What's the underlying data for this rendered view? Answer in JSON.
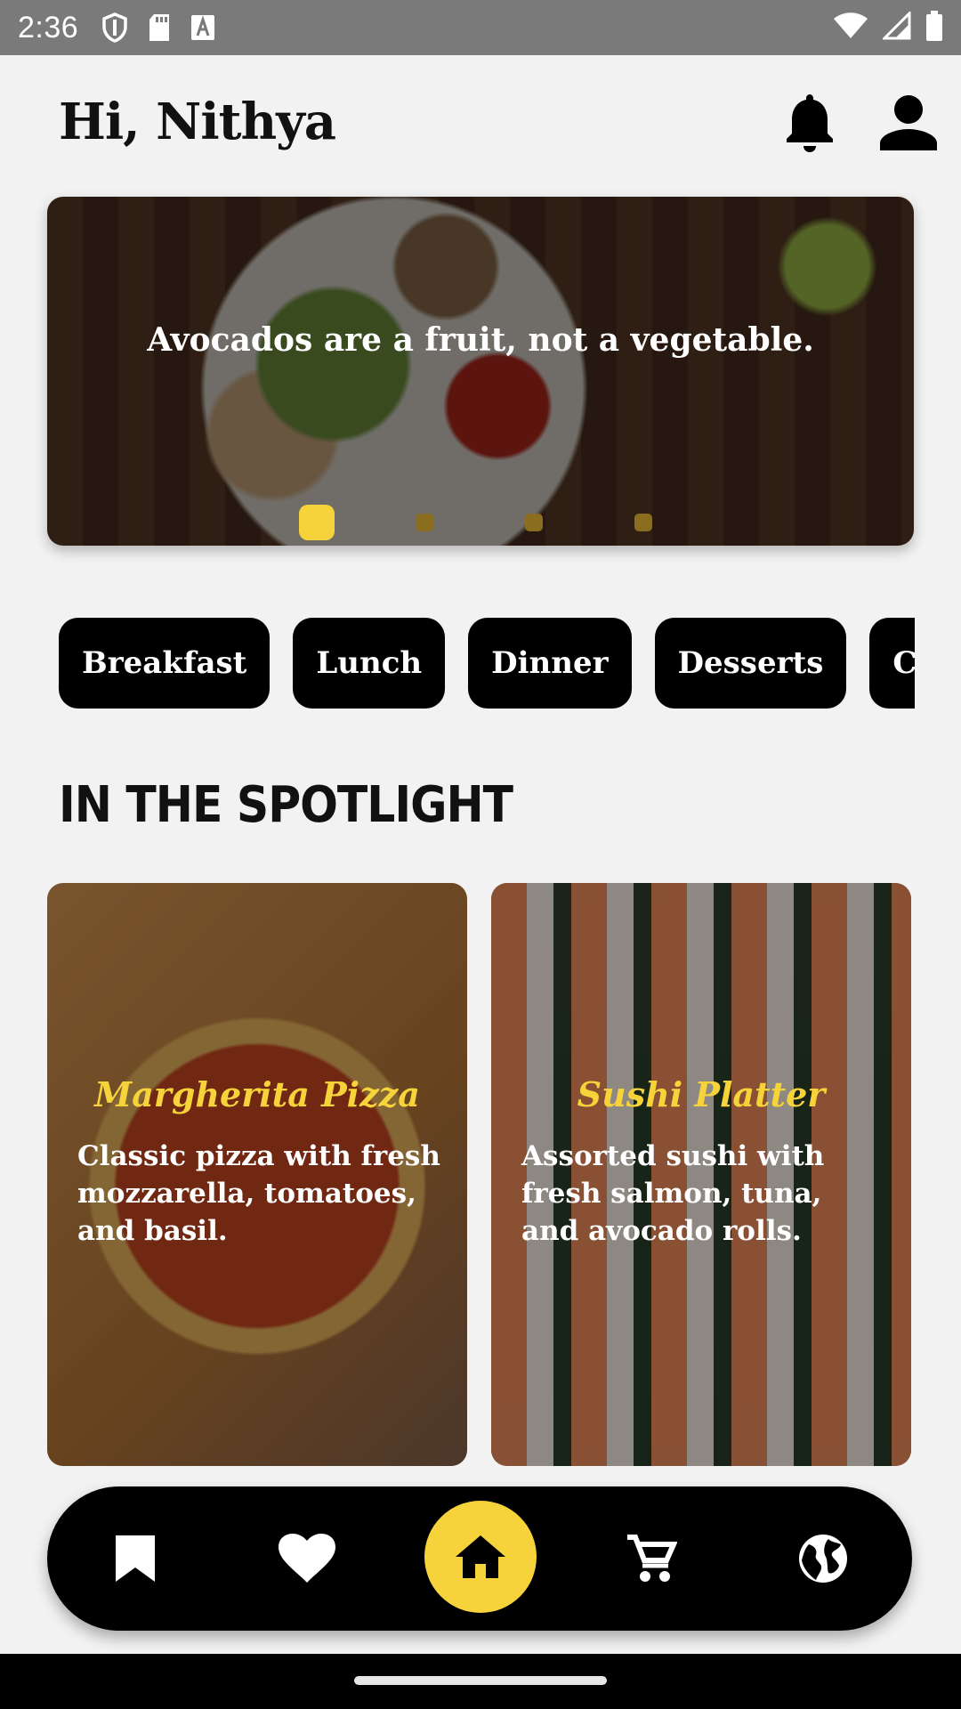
{
  "status_bar": {
    "time": "2:36",
    "left_icons": [
      "shield-icon",
      "sd-card-icon",
      "font-a-icon"
    ],
    "right_icons": [
      "wifi-icon",
      "signal-icon",
      "battery-icon"
    ]
  },
  "header": {
    "greeting": "Hi, Nithya",
    "icons": [
      "bell-icon",
      "profile-icon"
    ]
  },
  "hero": {
    "text": "Avocados are a fruit, not a vegetable.",
    "slides": 4,
    "active_slide": 1
  },
  "categories": [
    "Breakfast",
    "Lunch",
    "Dinner",
    "Desserts",
    "Coffee"
  ],
  "spotlight": {
    "title": "IN THE SPOTLIGHT",
    "cards": [
      {
        "title": "Margherita Pizza",
        "description": "Classic pizza with fresh mozzarella, tomatoes, and basil."
      },
      {
        "title": "Sushi Platter",
        "description": "Assorted sushi with fresh salmon, tuna, and avocado rolls."
      }
    ]
  },
  "bottom_nav": {
    "items": [
      "bookmark-icon",
      "heart-icon",
      "home-icon",
      "cart-icon",
      "globe-icon"
    ],
    "active": "home-icon"
  },
  "colors": {
    "accent": "#f6d33a",
    "background": "#f2f2f2",
    "status_bar": "#7a7a7a"
  }
}
